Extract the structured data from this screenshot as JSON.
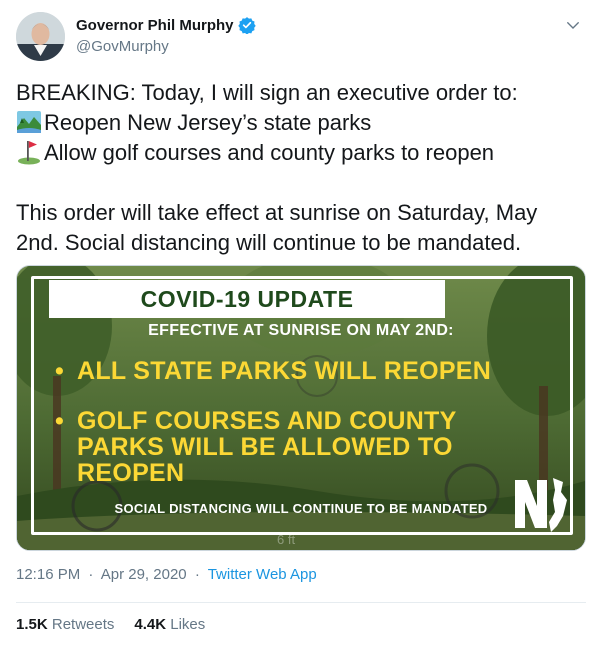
{
  "author": {
    "display_name": "Governor Phil Murphy",
    "handle": "@GovMurphy",
    "verified": true,
    "avatar_icon": "profile-photo"
  },
  "tweet": {
    "line1": "BREAKING: Today, I will sign an executive order to:",
    "line2_emoji": "national-park-icon",
    "line2": "Reopen New Jersey’s state parks",
    "line3_emoji": "golf-flag-icon",
    "line3": "Allow golf courses and county parks to reopen",
    "line4": "This order will take effect at sunrise on Saturday, May",
    "line5": "2nd. Social distancing will continue to be mandated."
  },
  "media": {
    "banner": "COVID-19 UPDATE",
    "effective": "EFFECTIVE AT SUNRISE ON MAY 2ND:",
    "bullet_symbol": "•",
    "bullet1": "ALL STATE PARKS WILL REOPEN",
    "bullet2_line1": "GOLF COURSES AND COUNTY",
    "bullet2_line2": "PARKS WILL BE ALLOWED TO",
    "bullet2_line3": "REOPEN",
    "footer": "SOCIAL DISTANCING WILL CONTINUE TO BE MANDATED",
    "logo_text": "NJ"
  },
  "meta": {
    "time": "12:16 PM",
    "separator": "·",
    "date": "Apr 29, 2020",
    "source": "Twitter Web App"
  },
  "stats": {
    "retweets_count": "1.5K",
    "retweets_label": "Retweets",
    "likes_count": "4.4K",
    "likes_label": "Likes"
  },
  "colors": {
    "verified_blue": "#1da1f2",
    "banner_green": "#1f4a1c",
    "bullet_yellow": "#fcd835",
    "link_blue": "#1b95e0"
  }
}
